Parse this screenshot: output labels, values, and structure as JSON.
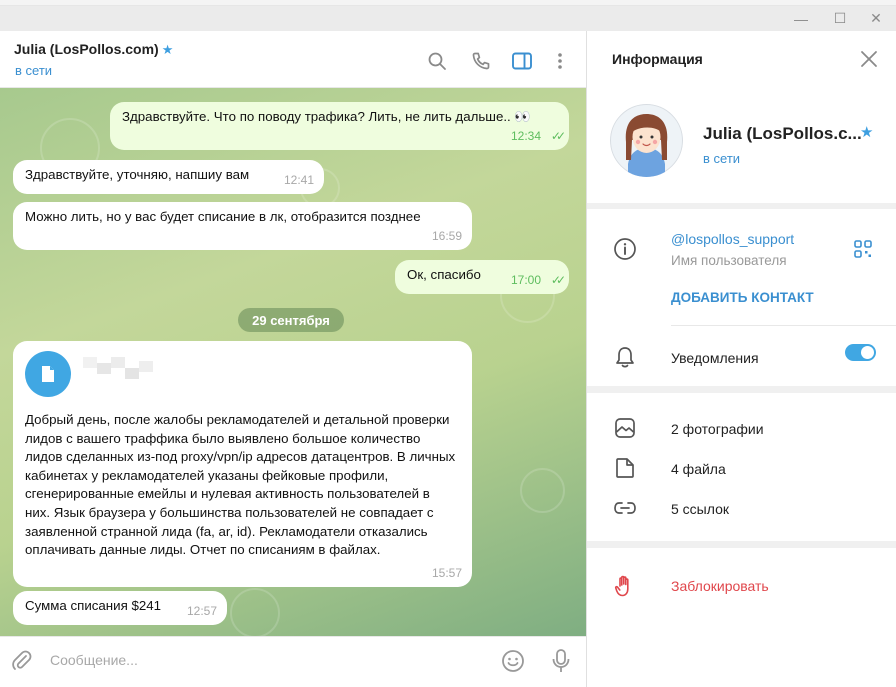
{
  "window": {
    "minimize": "—",
    "maximize": "☐",
    "close": "✕"
  },
  "chat": {
    "title": "Julia (LosPollos.com)",
    "status": "в сети",
    "date_separator": "29 сентября",
    "messages": [
      {
        "direction": "out",
        "text": "Здравствуйте. Что по поводу трафика? Лить, не лить дальше.. 👀",
        "time": "12:34"
      },
      {
        "direction": "in",
        "text": "Здравствуйте, уточняю, напшиу вам",
        "time": "12:41"
      },
      {
        "direction": "in",
        "text": "Можно лить, но у вас будет списание в лк, отобразится позднее",
        "time": "16:59"
      },
      {
        "direction": "out",
        "text": "Ок, спасибо",
        "time": "17:00"
      },
      {
        "direction": "in",
        "text": "Добрый день, после жалобы рекламодателей и детальной проверки лидов с вашего траффика было выявлено большое количество лидов сделанных из-под proxy/vpn/ip адресов датацентров. В личных кабинетах у рекламодателей указаны фейковые профили, сгенерированные емейлы и нулевая активность пользователей в них. Язык браузера у большинства пользователей не совпадает с заявленной странной лида (fa, ar, id). Рекламодатели отказались оплачивать данные лиды. Отчет по списаниям в файлах.",
        "time": "15:57"
      },
      {
        "direction": "in",
        "text": "Сумма списания $241",
        "time": "12:57"
      }
    ],
    "composer_placeholder": "Сообщение..."
  },
  "info_panel": {
    "title": "Информация",
    "name": "Julia (LosPollos.c...",
    "status": "в сети",
    "username": "@lospollos_support",
    "username_label": "Имя пользователя",
    "add_contact": "ДОБАВИТЬ КОНТАКТ",
    "notifications_label": "Уведомления",
    "notifications_on": true,
    "media": {
      "photos": "2 фотографии",
      "files": "4 файла",
      "links": "5 ссылок"
    },
    "block": "Заблокировать"
  },
  "colors": {
    "accent": "#3a8fd0",
    "outgoing_bubble": "#effdde",
    "read_checks": "#5ebd5e",
    "danger": "#e0474c"
  }
}
